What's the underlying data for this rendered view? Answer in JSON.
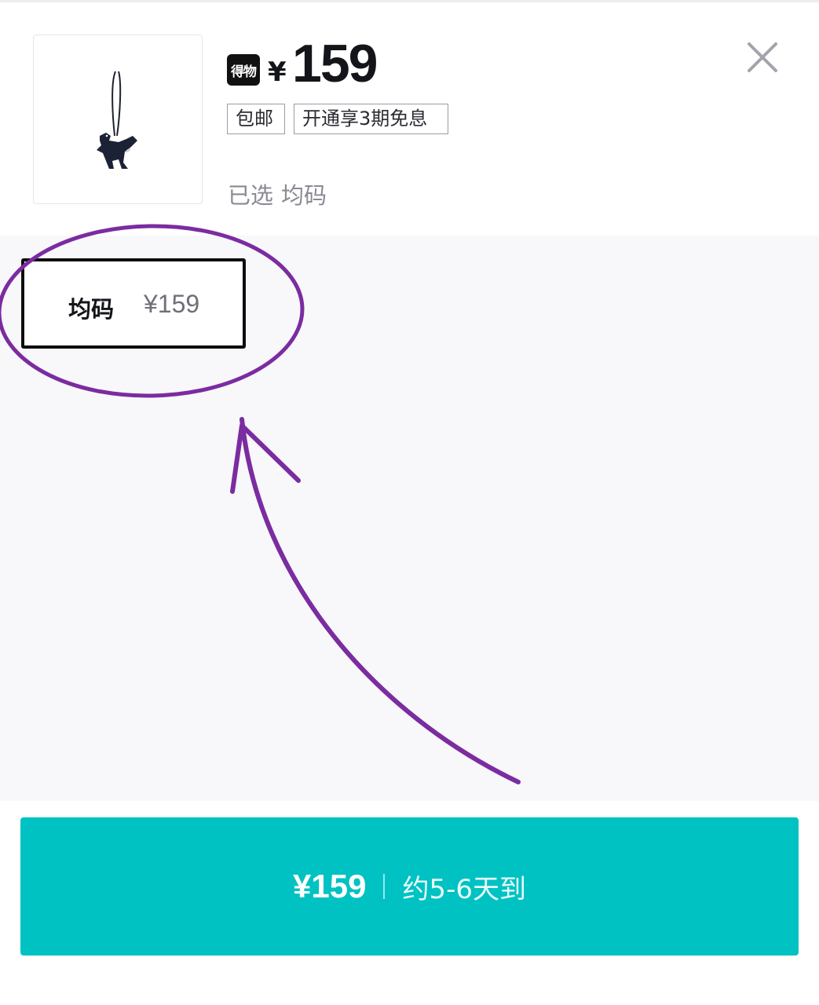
{
  "header": {
    "brand_badge": "得物",
    "price_symbol": "¥",
    "price": "159",
    "tags": {
      "shipping": "包邮",
      "installment": "开通享3期免息"
    },
    "selected_label": "已选",
    "selected_value": "均码",
    "close_icon": "close-icon"
  },
  "product_image": {
    "icon": "dinosaur-keychain-image"
  },
  "size_options": [
    {
      "label": "均码",
      "price": "¥159",
      "selected": true
    }
  ],
  "buy_button": {
    "price": "¥159",
    "delivery": "约5-6天到"
  },
  "colors": {
    "accent": "#00c2c3",
    "annotation": "#7b2ca0",
    "background_area": "#f8f7fa",
    "text_primary": "#14151a",
    "text_secondary": "#8a8a94"
  }
}
